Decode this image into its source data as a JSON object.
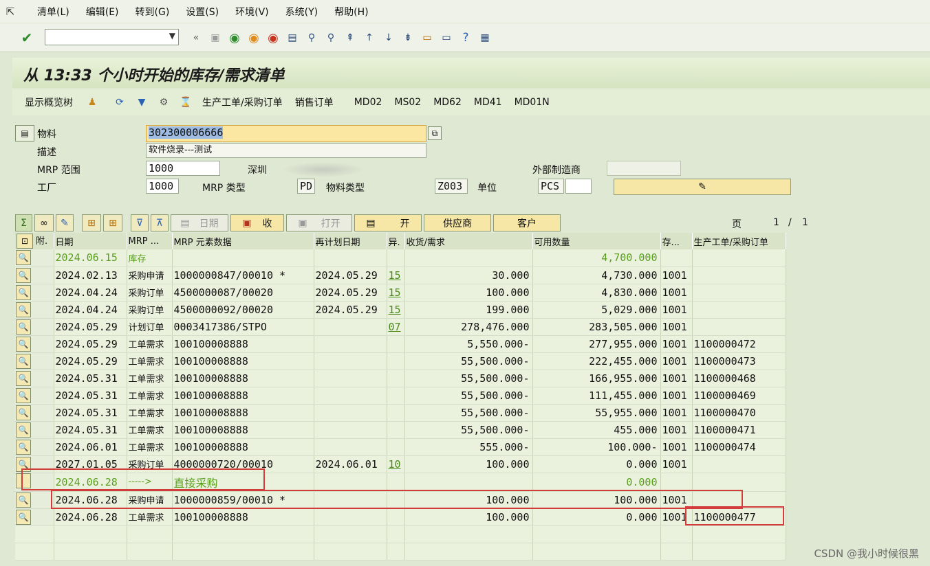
{
  "menu": [
    "清单(L)",
    "编辑(E)",
    "转到(G)",
    "设置(S)",
    "环境(V)",
    "系统(Y)",
    "帮助(H)"
  ],
  "title": "从 13:33 个小时开始的库存/需求清单",
  "app_toolbar": {
    "show_tree": "显示概览树",
    "prod_po": "生产工单/采购订单",
    "sales_order": "销售订单",
    "tx": [
      "MD02",
      "MS02",
      "MD62",
      "MD41",
      "MD01N"
    ]
  },
  "header": {
    "material_label": "物料",
    "material_value": "302300006666",
    "desc_label": "描述",
    "desc_value": "软件烧录---测试",
    "mrp_area_label": "MRP 范围",
    "mrp_area_value": "1000",
    "mrp_area_text": "深圳",
    "ext_mfr_label": "外部制造商",
    "plant_label": "工厂",
    "plant_value": "1000",
    "mrp_type_label": "MRP 类型",
    "mrp_type_value": "PD",
    "mat_type_label": "物料类型",
    "mat_type_value": "Z003",
    "unit_label": "单位",
    "unit_value": "PCS"
  },
  "list_buttons": {
    "date": "日期",
    "receipt": "收",
    "open": "打开",
    "open2": "开",
    "vendor": "供应商",
    "customer": "客户"
  },
  "pager": {
    "label": "页",
    "current": "1",
    "sep": "/",
    "total": "1"
  },
  "columns": [
    "附.",
    "日期",
    "MRP ...",
    "MRP 元素数据",
    "再计划日期",
    "异.",
    "收货/需求",
    "可用数量",
    "存...",
    "生产工单/采购订单"
  ],
  "rows": [
    {
      "date": "2024.06.15",
      "mrp": "库存",
      "data": "",
      "resched": "",
      "exc": "",
      "qty": "",
      "avail": "4,700.000",
      "stor": "",
      "order": "",
      "style": "green"
    },
    {
      "date": "2024.02.13",
      "mrp": "采购申请",
      "data": "1000000847/00010 *",
      "resched": "2024.05.29",
      "exc": "15",
      "qty": "30.000",
      "avail": "4,730.000",
      "stor": "1001",
      "order": ""
    },
    {
      "date": "2024.04.24",
      "mrp": "采购订单",
      "data": "4500000087/00020",
      "resched": "2024.05.29",
      "exc": "15",
      "qty": "100.000",
      "avail": "4,830.000",
      "stor": "1001",
      "order": ""
    },
    {
      "date": "2024.04.24",
      "mrp": "采购订单",
      "data": "4500000092/00020",
      "resched": "2024.05.29",
      "exc": "15",
      "qty": "199.000",
      "avail": "5,029.000",
      "stor": "1001",
      "order": ""
    },
    {
      "date": "2024.05.29",
      "mrp": "计划订单",
      "data": "0003417386/STPO",
      "resched": "",
      "exc": "07",
      "qty": "278,476.000",
      "avail": "283,505.000",
      "stor": "1001",
      "order": ""
    },
    {
      "date": "2024.05.29",
      "mrp": "工单需求",
      "data": "100100008888",
      "resched": "",
      "exc": "",
      "qty": "5,550.000-",
      "avail": "277,955.000",
      "stor": "1001",
      "order": "1100000472"
    },
    {
      "date": "2024.05.29",
      "mrp": "工单需求",
      "data": "100100008888",
      "resched": "",
      "exc": "",
      "qty": "55,500.000-",
      "avail": "222,455.000",
      "stor": "1001",
      "order": "1100000473"
    },
    {
      "date": "2024.05.31",
      "mrp": "工单需求",
      "data": "100100008888",
      "resched": "",
      "exc": "",
      "qty": "55,500.000-",
      "avail": "166,955.000",
      "stor": "1001",
      "order": "1100000468"
    },
    {
      "date": "2024.05.31",
      "mrp": "工单需求",
      "data": "100100008888",
      "resched": "",
      "exc": "",
      "qty": "55,500.000-",
      "avail": "111,455.000",
      "stor": "1001",
      "order": "1100000469"
    },
    {
      "date": "2024.05.31",
      "mrp": "工单需求",
      "data": "100100008888",
      "resched": "",
      "exc": "",
      "qty": "55,500.000-",
      "avail": "55,955.000",
      "stor": "1001",
      "order": "1100000470"
    },
    {
      "date": "2024.05.31",
      "mrp": "工单需求",
      "data": "100100008888",
      "resched": "",
      "exc": "",
      "qty": "55,500.000-",
      "avail": "455.000",
      "stor": "1001",
      "order": "1100000471"
    },
    {
      "date": "2024.06.01",
      "mrp": "工单需求",
      "data": "100100008888",
      "resched": "",
      "exc": "",
      "qty": "555.000-",
      "avail": "100.000-",
      "stor": "1001",
      "order": "1100000474"
    },
    {
      "date": "2027.01.05",
      "mrp": "采购订单",
      "data": "4000000720/00010",
      "resched": "2024.06.01",
      "exc": "10",
      "qty": "100.000",
      "avail": "0.000",
      "stor": "1001",
      "order": ""
    },
    {
      "date": "2024.06.28",
      "mrp": "----->",
      "data": "直接采购",
      "resched": "",
      "exc": "",
      "qty": "",
      "avail": "0.000",
      "stor": "",
      "order": "",
      "style": "green"
    },
    {
      "date": "2024.06.28",
      "mrp": "采购申请",
      "data": "1000000859/00010 *",
      "resched": "",
      "exc": "",
      "qty": "100.000",
      "avail": "100.000",
      "stor": "1001",
      "order": ""
    },
    {
      "date": "2024.06.28",
      "mrp": "工单需求",
      "data": "100100008888",
      "resched": "",
      "exc": "",
      "qty": "100.000",
      "avail": "0.000",
      "stor": "1001",
      "order": "1100000477"
    }
  ],
  "watermark": "CSDN @我小时候很黑"
}
